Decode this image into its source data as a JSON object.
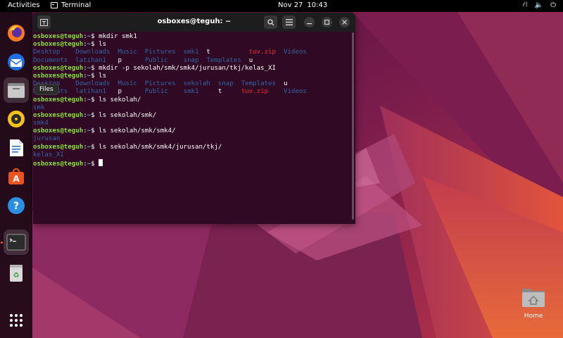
{
  "topbar": {
    "activities": "Activities",
    "app_name": "Terminal",
    "date": "Nov 27",
    "time": "10:43"
  },
  "dock": {
    "tooltip": "Files",
    "items": [
      "firefox-icon",
      "thunderbird-icon",
      "files-icon",
      "rhythmbox-icon",
      "writer-icon",
      "software-icon",
      "help-icon",
      "terminal-icon",
      "trash-icon",
      "app-grid-icon"
    ]
  },
  "terminal": {
    "title": "osboxes@teguh: ~",
    "prompt_user": "osboxes@teguh",
    "prompt_sep": ":",
    "prompt_dir": "~",
    "prompt_end": "$ ",
    "lines": [
      {
        "type": "cmd",
        "text": "mkdir smk1"
      },
      {
        "type": "cmd",
        "text": "ls"
      },
      {
        "type": "out",
        "items": [
          [
            "Desktop",
            "dir"
          ],
          [
            "    ",
            ""
          ],
          [
            "Downloads",
            "dir"
          ],
          [
            "  ",
            ""
          ],
          [
            "Music",
            "dir"
          ],
          [
            "  ",
            ""
          ],
          [
            "Pictures",
            "dir"
          ],
          [
            "  ",
            ""
          ],
          [
            "smk1",
            "dir"
          ],
          [
            "  ",
            ""
          ],
          [
            "t",
            "file"
          ],
          [
            "          ",
            ""
          ],
          [
            "tuv.zip",
            "zip"
          ],
          [
            "  ",
            ""
          ],
          [
            "Videos",
            "dir"
          ]
        ]
      },
      {
        "type": "out",
        "items": [
          [
            "Documents",
            "dir"
          ],
          [
            "  ",
            ""
          ],
          [
            "latihan1",
            "dir"
          ],
          [
            "   ",
            ""
          ],
          [
            "p",
            "file"
          ],
          [
            "      ",
            ""
          ],
          [
            "Public",
            "dir"
          ],
          [
            "    ",
            ""
          ],
          [
            "snap",
            "dir"
          ],
          [
            "  ",
            ""
          ],
          [
            "Templates",
            "dir"
          ],
          [
            "  ",
            ""
          ],
          [
            "u",
            "file"
          ]
        ]
      },
      {
        "type": "cmd",
        "text": "mkdir -p sekolah/smk/smk4/jurusan/tkj/kelas_XI"
      },
      {
        "type": "cmd",
        "text": "ls"
      },
      {
        "type": "out",
        "items": [
          [
            "Desktop",
            "dir"
          ],
          [
            "    ",
            ""
          ],
          [
            "Downloads",
            "dir"
          ],
          [
            "  ",
            ""
          ],
          [
            "Music",
            "dir"
          ],
          [
            "  ",
            ""
          ],
          [
            "Pictures",
            "dir"
          ],
          [
            "  ",
            ""
          ],
          [
            "sekolah",
            "dir"
          ],
          [
            "  ",
            ""
          ],
          [
            "snap",
            "dir"
          ],
          [
            "  ",
            ""
          ],
          [
            "Templates",
            "dir"
          ],
          [
            "  ",
            ""
          ],
          [
            "u",
            "file"
          ]
        ]
      },
      {
        "type": "out",
        "items": [
          [
            "Documents",
            "dir"
          ],
          [
            "  ",
            ""
          ],
          [
            "latihan1",
            "dir"
          ],
          [
            "   ",
            ""
          ],
          [
            "p",
            "file"
          ],
          [
            "      ",
            ""
          ],
          [
            "Public",
            "dir"
          ],
          [
            "    ",
            ""
          ],
          [
            "smk1",
            "dir"
          ],
          [
            "     ",
            ""
          ],
          [
            "t",
            "file"
          ],
          [
            "     ",
            ""
          ],
          [
            "tuv.zip",
            "zip"
          ],
          [
            "    ",
            ""
          ],
          [
            "Videos",
            "dir"
          ]
        ]
      },
      {
        "type": "cmd",
        "text": "ls sekolah/"
      },
      {
        "type": "out",
        "items": [
          [
            "smk",
            "dir"
          ]
        ]
      },
      {
        "type": "cmd",
        "text": "ls sekolah/smk/"
      },
      {
        "type": "out",
        "items": [
          [
            "smk4",
            "dir"
          ]
        ]
      },
      {
        "type": "cmd",
        "text": "ls sekolah/smk/smk4/"
      },
      {
        "type": "out",
        "items": [
          [
            "jurusan",
            "dir"
          ]
        ]
      },
      {
        "type": "cmd",
        "text": "ls sekolah/smk/smk4/jurusan/tkj/"
      },
      {
        "type": "out",
        "items": [
          [
            "kelas_XI",
            "dir"
          ]
        ]
      },
      {
        "type": "prompt",
        "text": ""
      }
    ]
  },
  "desktop": {
    "home_label": "Home"
  },
  "colors": {
    "terminal_bg": "#300a24",
    "prompt_user": "#8ae234",
    "prompt_dir": "#729fcf",
    "dir_color": "#3465a4",
    "zip_color": "#ef2929",
    "accent": "#e95420"
  }
}
